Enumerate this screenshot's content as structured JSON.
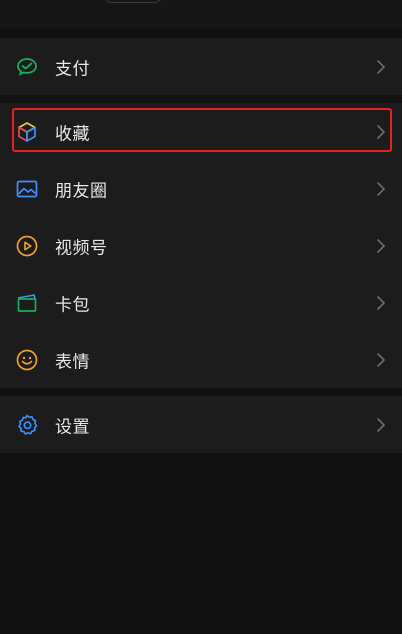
{
  "menu": {
    "pay": {
      "label": "支付",
      "icon": "wechat-pay-icon"
    },
    "favorites": {
      "label": "收藏",
      "icon": "favorites-cube-icon"
    },
    "moments": {
      "label": "朋友圈",
      "icon": "moments-picture-icon"
    },
    "channels": {
      "label": "视频号",
      "icon": "channels-play-icon"
    },
    "cards": {
      "label": "卡包",
      "icon": "card-wallet-icon"
    },
    "stickers": {
      "label": "表情",
      "icon": "sticker-smile-icon"
    },
    "settings": {
      "label": "设置",
      "icon": "settings-gear-icon"
    }
  },
  "colors": {
    "background": "#111111",
    "row": "#1c1c1c",
    "text": "#e8e8e8",
    "highlight": "#e8231f",
    "pay_green": "#1aad5a",
    "blue": "#3d8fff",
    "orange": "#f0a030"
  }
}
